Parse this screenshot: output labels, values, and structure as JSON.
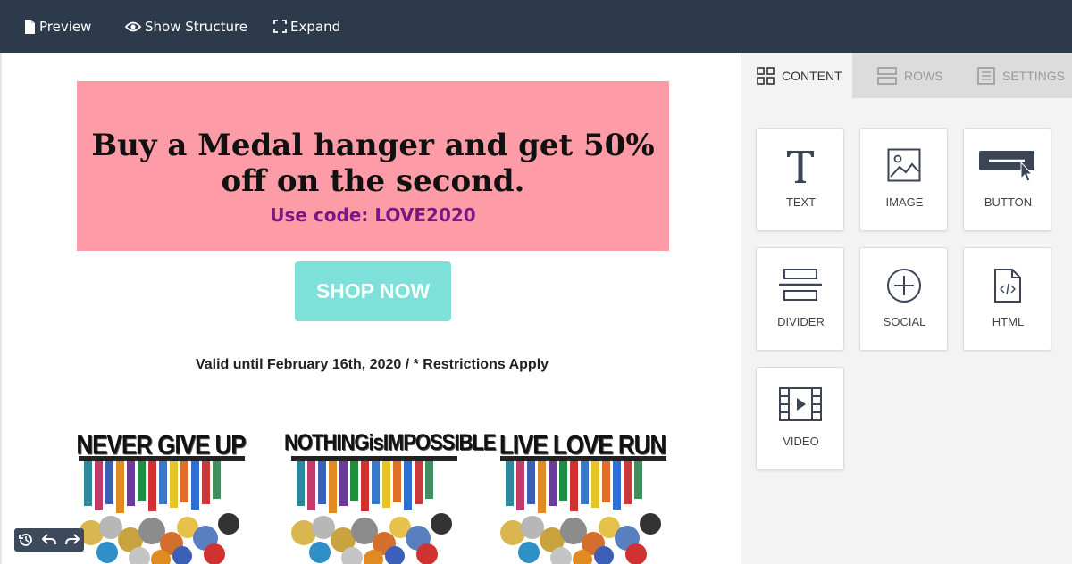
{
  "toolbar": {
    "preview": "Preview",
    "show_structure": "Show Structure",
    "expand": "Expand"
  },
  "email": {
    "headline_line1": "Buy a Medal hanger and get 50%",
    "headline_line2": "off on the second.",
    "code": "Use code: LOVE2020",
    "shop_button": "SHOP NOW",
    "valid_text": "Valid until February 16th, 2020 / * Restrictions Apply",
    "hangers": [
      {
        "title": "NEVER GIVE UP"
      },
      {
        "title": "NOTHINGisIMPOSSIBLE"
      },
      {
        "title": "LIVE LOVE RUN"
      }
    ]
  },
  "panel": {
    "tabs": [
      {
        "label": "CONTENT",
        "icon": "grid-icon"
      },
      {
        "label": "ROWS",
        "icon": "rows-icon"
      },
      {
        "label": "SETTINGS",
        "icon": "settings-icon"
      }
    ],
    "tiles": [
      {
        "label": "TEXT",
        "icon": "text-icon"
      },
      {
        "label": "IMAGE",
        "icon": "image-icon"
      },
      {
        "label": "BUTTON",
        "icon": "button-icon"
      },
      {
        "label": "DIVIDER",
        "icon": "divider-icon"
      },
      {
        "label": "SOCIAL",
        "icon": "social-icon"
      },
      {
        "label": "HTML",
        "icon": "html-icon"
      },
      {
        "label": "VIDEO",
        "icon": "video-icon"
      }
    ]
  },
  "colors": {
    "toolbar_bg": "#2d3a4b",
    "promo_bg": "#fd9ca6",
    "code_color": "#7b1784",
    "shop_button_bg": "#7ee0d8"
  }
}
